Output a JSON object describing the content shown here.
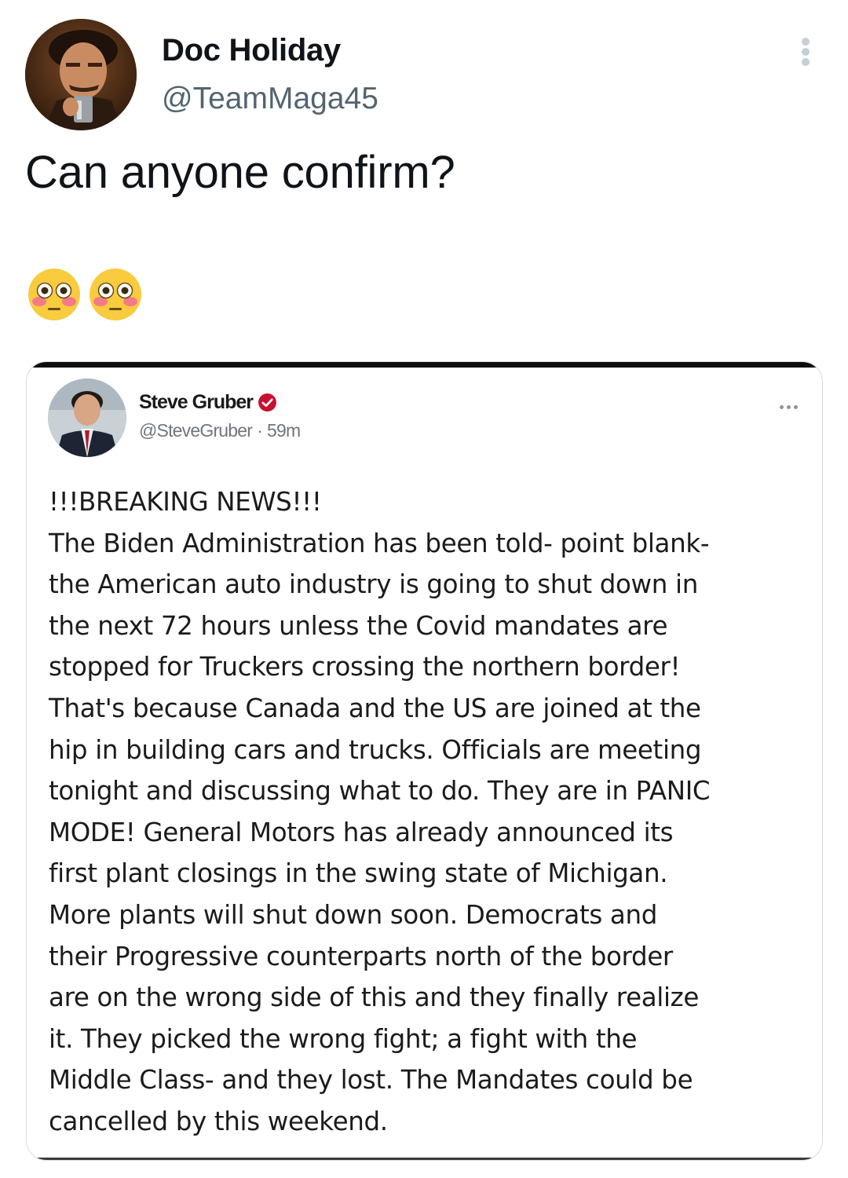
{
  "tweet": {
    "author": {
      "display_name": "Doc Holiday",
      "handle": "@TeamMaga45"
    },
    "text": "Can anyone confirm?",
    "emojis": [
      "flushed-face",
      "flushed-face"
    ],
    "more_icon": "vertical-ellipsis-icon"
  },
  "embedded_screenshot": {
    "author": {
      "display_name": "Steve Gruber",
      "verified_badge": "verified-badge-icon",
      "handle": "@SteveGruber",
      "separator": "·",
      "time": "59m"
    },
    "more_icon": "horizontal-ellipsis-icon",
    "body_lines": [
      "!!!BREAKING NEWS!!!",
      "The Biden Administration has been told- point blank-",
      "the American auto industry is going to shut down in",
      "the next 72 hours unless the Covid mandates are",
      "stopped for Truckers crossing the northern border!",
      "That's because Canada and the US are joined at the",
      "hip in building cars and trucks. Officials are meeting",
      "tonight and discussing what to do. They are in PANIC",
      "MODE! General Motors has already announced its",
      "first plant closings in the swing state of Michigan.",
      "More plants will shut down soon. Democrats and",
      "their Progressive counterparts north of the border",
      "are on the wrong side of this and they finally realize",
      "it. They picked the wrong fight; a fight with the",
      "Middle Class- and they lost. The Mandates could be",
      "cancelled by this weekend."
    ]
  },
  "colors": {
    "primary_text": "#0f1419",
    "secondary_text": "#536471",
    "verified_red": "#c8102e"
  }
}
